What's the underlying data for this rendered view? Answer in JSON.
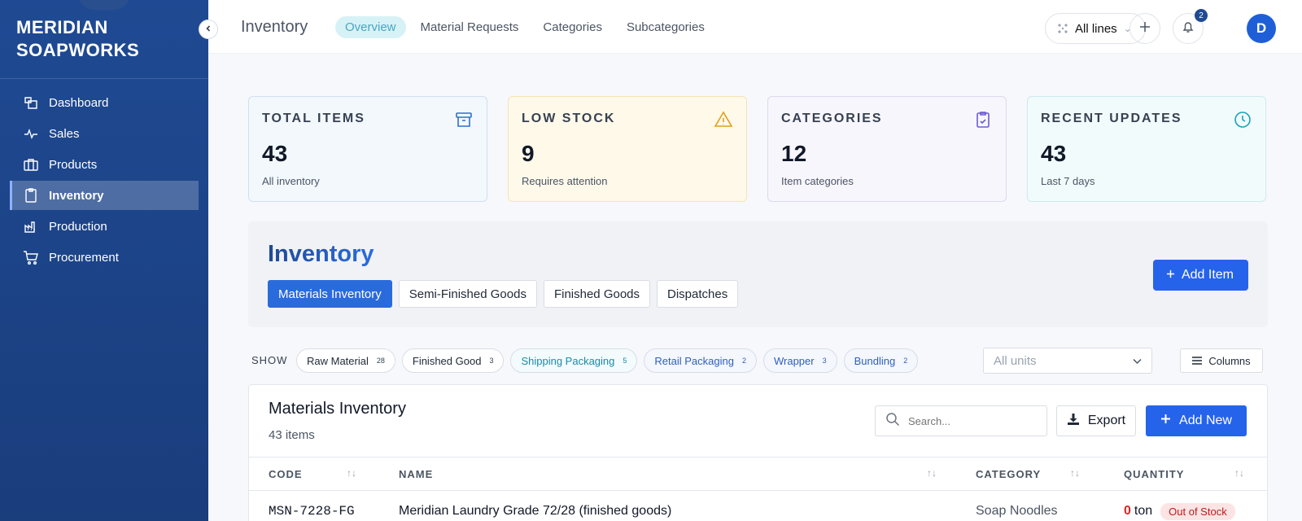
{
  "brand": {
    "line1": "MERIDIAN",
    "line2": "SOAPWORKS"
  },
  "sidebar": {
    "items": [
      {
        "label": "Dashboard",
        "icon": "dashboard-icon"
      },
      {
        "label": "Sales",
        "icon": "sales-icon"
      },
      {
        "label": "Products",
        "icon": "products-icon"
      },
      {
        "label": "Inventory",
        "icon": "inventory-icon",
        "active": true
      },
      {
        "label": "Production",
        "icon": "production-icon"
      },
      {
        "label": "Procurement",
        "icon": "cart-icon"
      }
    ]
  },
  "topbar": {
    "title": "Inventory",
    "tabs": [
      {
        "label": "Overview",
        "active": true
      },
      {
        "label": "Material Requests"
      },
      {
        "label": "Categories"
      },
      {
        "label": "Subcategories"
      }
    ],
    "lines_selector": "All lines",
    "notification_count": "2",
    "avatar_initial": "D"
  },
  "stats": [
    {
      "label": "TOTAL ITEMS",
      "value": "43",
      "sub": "All inventory",
      "icon": "archive-icon",
      "color": "#2e6fd1"
    },
    {
      "label": "LOW STOCK",
      "value": "9",
      "sub": "Requires attention",
      "icon": "warning-icon",
      "color": "#e0a01b"
    },
    {
      "label": "CATEGORIES",
      "value": "12",
      "sub": "Item categories",
      "icon": "clipboard-icon",
      "color": "#6b5bd6"
    },
    {
      "label": "RECENT UPDATES",
      "value": "43",
      "sub": "Last 7 days",
      "icon": "clock-icon",
      "color": "#1aa3b8"
    }
  ],
  "inventory": {
    "heading": "Inventory",
    "add_item_label": "Add Item",
    "tabs": [
      {
        "label": "Materials Inventory",
        "active": true
      },
      {
        "label": "Semi-Finished Goods"
      },
      {
        "label": "Finished Goods"
      },
      {
        "label": "Dispatches"
      }
    ]
  },
  "filters": {
    "show_label": "SHOW",
    "chips": [
      {
        "label": "Raw Material",
        "count": "28",
        "style": "plain"
      },
      {
        "label": "Finished Good",
        "count": "3",
        "style": "plain"
      },
      {
        "label": "Shipping Packaging",
        "count": "5",
        "style": "cyan"
      },
      {
        "label": "Retail Packaging",
        "count": "2",
        "style": "blue"
      },
      {
        "label": "Wrapper",
        "count": "3",
        "style": "blue"
      },
      {
        "label": "Bundling",
        "count": "2",
        "style": "blue"
      }
    ],
    "units_placeholder": "All units",
    "columns_label": "Columns"
  },
  "table": {
    "title": "Materials Inventory",
    "count_label": "43 items",
    "search_placeholder": "Search...",
    "export_label": "Export",
    "add_new_label": "Add New",
    "columns": [
      "CODE",
      "NAME",
      "CATEGORY",
      "QUANTITY"
    ],
    "rows": [
      {
        "code": "MSN-7228-FG",
        "name": "Meridian Laundry Grade 72/28 (finished goods)",
        "category": "Soap Noodles",
        "quantity": "0",
        "unit": "ton",
        "status": "Out of Stock"
      }
    ]
  },
  "colors": {
    "primary": "#2563eb",
    "sidebar": "#1f4a93",
    "danger": "#dc2626"
  }
}
